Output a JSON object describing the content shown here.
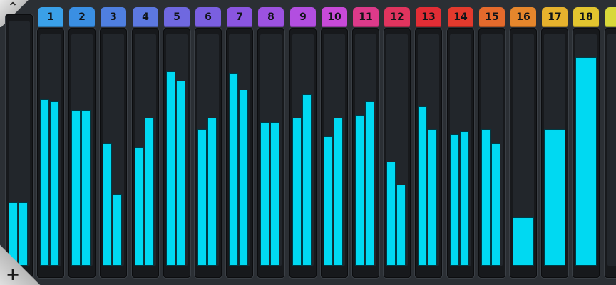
{
  "controls": {
    "scroll_up_glyph": "⌃",
    "add_glyph": "+"
  },
  "left_meter": {
    "left_level": 0.26,
    "right_level": 0.26
  },
  "channels": [
    {
      "label": "1",
      "color": "#3aa0e8",
      "left": 0.72,
      "right": 0.71
    },
    {
      "label": "2",
      "color": "#3a8fe3",
      "left": 0.67,
      "right": 0.67
    },
    {
      "label": "3",
      "color": "#4f7fe0",
      "left": 0.53,
      "right": 0.31
    },
    {
      "label": "4",
      "color": "#5c78e0",
      "left": 0.51,
      "right": 0.64
    },
    {
      "label": "5",
      "color": "#6f68e0",
      "left": 0.84,
      "right": 0.8
    },
    {
      "label": "6",
      "color": "#7a5fe0",
      "left": 0.59,
      "right": 0.64
    },
    {
      "label": "7",
      "color": "#8a55e0",
      "left": 0.83,
      "right": 0.76
    },
    {
      "label": "8",
      "color": "#9c52e0",
      "left": 0.62,
      "right": 0.62
    },
    {
      "label": "9",
      "color": "#b24ee0",
      "left": 0.64,
      "right": 0.74
    },
    {
      "label": "10",
      "color": "#c74ad8",
      "left": 0.56,
      "right": 0.64
    },
    {
      "label": "11",
      "color": "#dc3a8a",
      "left": 0.65,
      "right": 0.71
    },
    {
      "label": "12",
      "color": "#e0345e",
      "left": 0.45,
      "right": 0.35
    },
    {
      "label": "13",
      "color": "#e32d35",
      "left": 0.69,
      "right": 0.59
    },
    {
      "label": "14",
      "color": "#e33a2d",
      "left": 0.57,
      "right": 0.58
    },
    {
      "label": "15",
      "color": "#e46a2c",
      "left": 0.59,
      "right": 0.53
    },
    {
      "label": "16",
      "color": "#e5862c",
      "mono": 0.21
    },
    {
      "label": "17",
      "color": "#e6b22d",
      "mono": 0.59
    },
    {
      "label": "18",
      "color": "#e3c52f",
      "mono": 0.9
    },
    {
      "label": "",
      "color": "#d8d83a",
      "mono": 0.0
    }
  ]
}
